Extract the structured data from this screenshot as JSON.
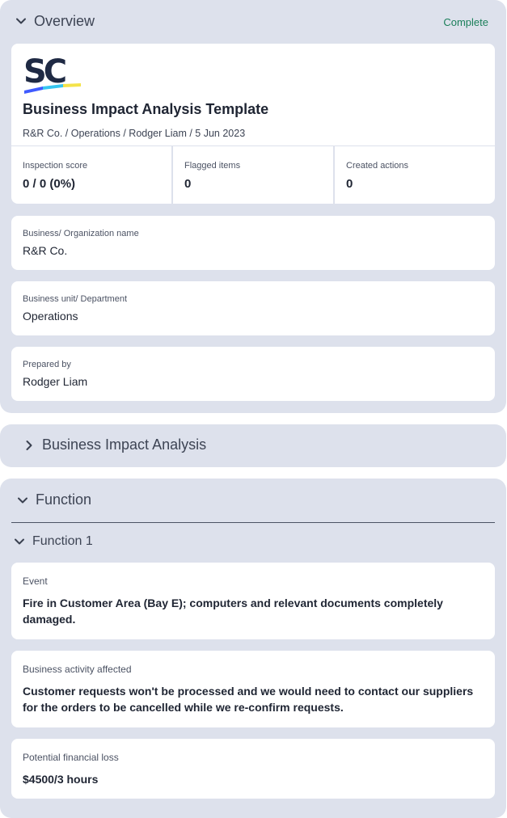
{
  "overview": {
    "title": "Overview",
    "status": "Complete",
    "document": {
      "title": "Business Impact Analysis Template",
      "meta": "R&R Co. / Operations / Rodger Liam / 5 Jun 2023"
    },
    "stats": [
      {
        "label": "Inspection score",
        "value": "0 / 0 (0%)"
      },
      {
        "label": "Flagged items",
        "value": "0"
      },
      {
        "label": "Created actions",
        "value": "0"
      }
    ],
    "fields": {
      "org": {
        "label": "Business/ Organization name",
        "value": "R&R Co."
      },
      "unit": {
        "label": "Business unit/ Department",
        "value": "Operations"
      },
      "prepared": {
        "label": "Prepared by",
        "value": "Rodger Liam"
      }
    },
    "logo_text": "SC"
  },
  "bia": {
    "title": "Business Impact Analysis"
  },
  "function": {
    "title": "Function",
    "subsection": {
      "title": "Function 1",
      "questions": {
        "event": {
          "label": "Event",
          "value": "Fire in Customer Area (Bay E); computers and relevant documents completely damaged."
        },
        "activity": {
          "label": "Business activity affected",
          "value": "Customer requests won't be processed and we would need to contact our suppliers for the orders to be cancelled while we re-confirm requests."
        },
        "loss": {
          "label": "Potential financial loss",
          "value": "$4500/3 hours"
        }
      }
    }
  },
  "colors": {
    "section_bg": "#dde1ec",
    "status_green": "#1b7f5a",
    "logo_navy": "#1f2a44",
    "logo_stripe": [
      "#3f5bff",
      "#36c6f0",
      "#f4e34a"
    ]
  },
  "icons": {
    "expanded": "chevron-down-icon",
    "collapsed": "chevron-right-icon"
  }
}
